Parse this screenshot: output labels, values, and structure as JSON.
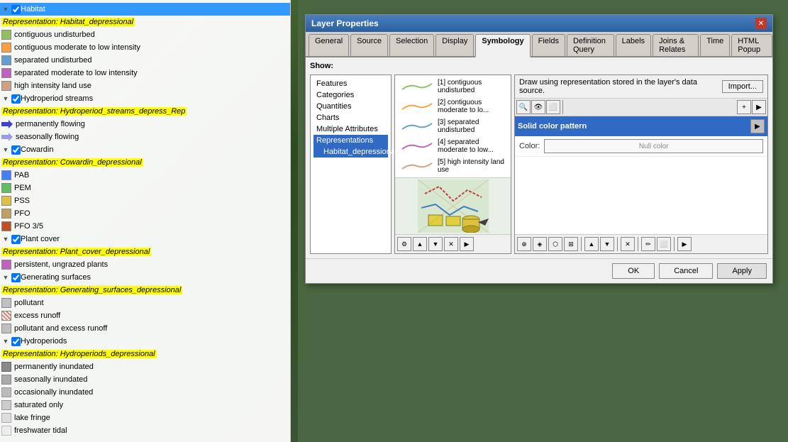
{
  "map": {
    "bg_color": "#4a6741"
  },
  "layer_panel": {
    "groups": [
      {
        "id": "habitat",
        "label": "Habitat",
        "checked": true,
        "highlighted": true,
        "repr": "Representation: Habitat_depressional",
        "items": [
          {
            "label": "contiguous undisturbed",
            "color": "#90C060",
            "type": "line"
          },
          {
            "label": "contiguous moderate to low intensity",
            "color": "#FFA040",
            "type": "line"
          },
          {
            "label": "separated undisturbed",
            "color": "#60A0D0",
            "type": "line"
          },
          {
            "label": "separated moderate to low intensity",
            "color": "#C060C0",
            "type": "line"
          },
          {
            "label": "high intensity land use",
            "color": "#D0A080",
            "type": "line"
          }
        ]
      },
      {
        "id": "hydroperiod_streams",
        "label": "Hydroperiod streams",
        "checked": true,
        "repr": "Representation: Hydroperiod_streams_depress_Rep",
        "items": [
          {
            "label": "permanently flowing",
            "color": "#4040D0",
            "type": "arrow"
          },
          {
            "label": "seasonally flowing",
            "color": "#4040D0",
            "type": "arrow"
          }
        ]
      },
      {
        "id": "cowardin",
        "label": "Cowardin",
        "checked": true,
        "repr": "Representation: Cowardin_depressional",
        "items": [
          {
            "label": "PAB",
            "color": "#4080FF",
            "type": "square"
          },
          {
            "label": "PEM",
            "color": "#60C060",
            "type": "square"
          },
          {
            "label": "PSS",
            "color": "#E0C040",
            "type": "square"
          },
          {
            "label": "PFO",
            "color": "#C0A060",
            "type": "square"
          },
          {
            "label": "PFO 3/5",
            "color": "#C05020",
            "type": "square"
          }
        ]
      },
      {
        "id": "plant_cover",
        "label": "Plant cover",
        "checked": true,
        "repr": "Representation: Plant_cover_depressional",
        "items": [
          {
            "label": "persistent, ungrazed plants",
            "color": "#C060C0",
            "type": "square"
          }
        ]
      },
      {
        "id": "generating_surfaces",
        "label": "Generating surfaces",
        "checked": true,
        "repr": "Representation: Generating_surfaces_depressional",
        "items": [
          {
            "label": "pollutant",
            "color": "#C0C0C0",
            "type": "hatch"
          },
          {
            "label": "excess runoff",
            "color": "#E08060",
            "type": "hatch"
          },
          {
            "label": "pollutant and excess runoff",
            "color": "#C0C0C0",
            "type": "hatch"
          }
        ]
      },
      {
        "id": "hydroperiods",
        "label": "Hydroperiods",
        "checked": true,
        "repr": "Representation: Hydroperiods_depressional",
        "items": [
          {
            "label": "permanently inundated",
            "color": "#888888",
            "type": "square"
          },
          {
            "label": "seasonally inundated",
            "color": "#aaaaaa",
            "type": "square"
          },
          {
            "label": "occasionally inundated",
            "color": "#bbbbbb",
            "type": "square"
          },
          {
            "label": "saturated only",
            "color": "#cccccc",
            "type": "square"
          },
          {
            "label": "lake fringe",
            "color": "#dddddd",
            "type": "square"
          },
          {
            "label": "freshwater tidal",
            "color": "#eeeeee",
            "type": "square"
          }
        ]
      }
    ]
  },
  "dialog": {
    "title": "Layer Properties",
    "tabs": [
      {
        "label": "General",
        "id": "general"
      },
      {
        "label": "Source",
        "id": "source"
      },
      {
        "label": "Selection",
        "id": "selection"
      },
      {
        "label": "Display",
        "id": "display"
      },
      {
        "label": "Symbology",
        "id": "symbology",
        "active": true
      },
      {
        "label": "Fields",
        "id": "fields"
      },
      {
        "label": "Definition Query",
        "id": "defquery"
      },
      {
        "label": "Labels",
        "id": "labels"
      },
      {
        "label": "Joins & Relates",
        "id": "joins"
      },
      {
        "label": "Time",
        "id": "time"
      },
      {
        "label": "HTML Popup",
        "id": "htmlpopup"
      }
    ],
    "show_label": "Show:",
    "show_options": [
      {
        "label": "Features",
        "id": "features"
      },
      {
        "label": "Categories",
        "id": "categories"
      },
      {
        "label": "Quantities",
        "id": "quantities"
      },
      {
        "label": "Charts",
        "id": "charts"
      },
      {
        "label": "Multiple Attributes",
        "id": "multiattr"
      },
      {
        "label": "Representations",
        "id": "representations",
        "active": true,
        "sub": [
          {
            "label": "Habitat_depressional",
            "active": true
          }
        ]
      }
    ],
    "draw_label": "Draw using representation stored in the layer's data source.",
    "import_btn": "Import...",
    "representations": [
      {
        "id": 1,
        "label": "[1] contiguous undisturbed",
        "color": "#90C060"
      },
      {
        "id": 2,
        "label": "[2] contiguous moderate to lo...",
        "color": "#FFA040"
      },
      {
        "id": 3,
        "label": "[3] separated undisturbed",
        "color": "#60A0D0"
      },
      {
        "id": 4,
        "label": "[4] separated moderate to low...",
        "color": "#C060C0"
      },
      {
        "id": 5,
        "label": "[5] high intensity land use",
        "color": "#D0A080"
      }
    ],
    "solid_color_label": "Solid color pattern",
    "color_label": "Color:",
    "null_color_label": "Null color",
    "footer": {
      "ok_label": "OK",
      "cancel_label": "Cancel",
      "apply_label": "Apply"
    }
  }
}
